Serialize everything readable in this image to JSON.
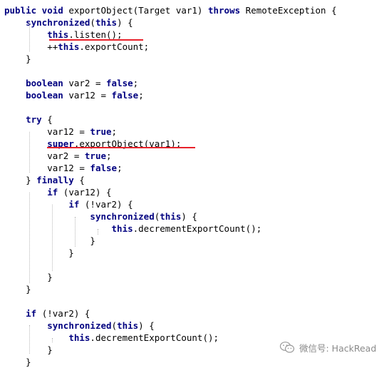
{
  "editor": {
    "lines": [
      [
        {
          "t": "public void ",
          "k": 1
        },
        {
          "t": "exportObject(Target var1) "
        },
        {
          "t": "throws ",
          "k": 1
        },
        {
          "t": "RemoteException {"
        }
      ],
      [
        {
          "t": "    "
        },
        {
          "t": "synchronized",
          "k": 1
        },
        {
          "t": "("
        },
        {
          "t": "this",
          "k": 1
        },
        {
          "t": ") {"
        }
      ],
      [
        {
          "t": "        "
        },
        {
          "t": "this",
          "k": 1
        },
        {
          "t": ".listen();"
        }
      ],
      [
        {
          "t": "        ++"
        },
        {
          "t": "this",
          "k": 1
        },
        {
          "t": ".exportCount;"
        }
      ],
      [
        {
          "t": "    }"
        }
      ],
      [],
      [
        {
          "t": "    "
        },
        {
          "t": "boolean ",
          "k": 1
        },
        {
          "t": "var2 = "
        },
        {
          "t": "false",
          "k": 1
        },
        {
          "t": ";"
        }
      ],
      [
        {
          "t": "    "
        },
        {
          "t": "boolean ",
          "k": 1
        },
        {
          "t": "var12 = "
        },
        {
          "t": "false",
          "k": 1
        },
        {
          "t": ";"
        }
      ],
      [],
      [
        {
          "t": "    "
        },
        {
          "t": "try ",
          "k": 1
        },
        {
          "t": "{"
        }
      ],
      [
        {
          "t": "        var12 = "
        },
        {
          "t": "true",
          "k": 1
        },
        {
          "t": ";"
        }
      ],
      [
        {
          "t": "        "
        },
        {
          "t": "super",
          "k": 1
        },
        {
          "t": ".exportObject(var1);"
        }
      ],
      [
        {
          "t": "        var2 = "
        },
        {
          "t": "true",
          "k": 1
        },
        {
          "t": ";"
        }
      ],
      [
        {
          "t": "        var12 = "
        },
        {
          "t": "false",
          "k": 1
        },
        {
          "t": ";"
        }
      ],
      [
        {
          "t": "    } "
        },
        {
          "t": "finally ",
          "k": 1
        },
        {
          "t": "{"
        }
      ],
      [
        {
          "t": "        "
        },
        {
          "t": "if ",
          "k": 1
        },
        {
          "t": "(var12) {"
        }
      ],
      [
        {
          "t": "            "
        },
        {
          "t": "if ",
          "k": 1
        },
        {
          "t": "(!var2) {"
        }
      ],
      [
        {
          "t": "                "
        },
        {
          "t": "synchronized",
          "k": 1
        },
        {
          "t": "("
        },
        {
          "t": "this",
          "k": 1
        },
        {
          "t": ") {"
        }
      ],
      [
        {
          "t": "                    "
        },
        {
          "t": "this",
          "k": 1
        },
        {
          "t": ".decrementExportCount();"
        }
      ],
      [
        {
          "t": "                }"
        }
      ],
      [
        {
          "t": "            }"
        }
      ],
      [],
      [
        {
          "t": "        }"
        }
      ],
      [
        {
          "t": "    }"
        }
      ],
      [],
      [
        {
          "t": "    "
        },
        {
          "t": "if ",
          "k": 1
        },
        {
          "t": "(!var2) {"
        }
      ],
      [
        {
          "t": "        "
        },
        {
          "t": "synchronized",
          "k": 1
        },
        {
          "t": "("
        },
        {
          "t": "this",
          "k": 1
        },
        {
          "t": ") {"
        }
      ],
      [
        {
          "t": "            "
        },
        {
          "t": "this",
          "k": 1
        },
        {
          "t": ".decrementExportCount();"
        }
      ],
      [
        {
          "t": "        }"
        }
      ],
      [
        {
          "t": "    }"
        }
      ]
    ]
  },
  "watermark": {
    "text": "微信号: HackRead",
    "icon": "wechat-icon"
  },
  "colors": {
    "keyword": "#000080",
    "text": "#000000",
    "underline": "#e8222b",
    "guide": "#b9b9b9",
    "watermark": "#8a8a8a"
  }
}
